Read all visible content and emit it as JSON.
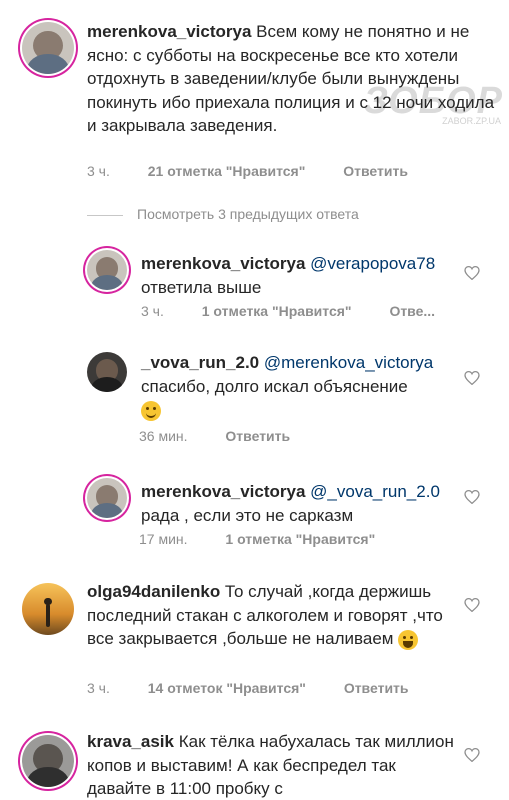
{
  "watermark": {
    "text": "ЗОБОР",
    "sub": "ZABOR.ZP.UA"
  },
  "view_replies": "Посмотреть 3 предыдущих ответа",
  "comments": [
    {
      "username": "merenkova_victorya",
      "text": " Всем кому не понятно и не ясно: с субботы на воскресенье все кто хотели отдохнуть в заведении/клубе были вынуждены покинуть ибо приехала полиция и с 12 ночи ходила и закрывала заведения.",
      "time": "3 ч.",
      "likes": "21 отметка \"Нравится\"",
      "reply": "Ответить"
    },
    {
      "username": "merenkova_victorya",
      "mention": " @verapopova78",
      "text": "ответила выше",
      "time": "3 ч.",
      "likes": "1 отметка \"Нравится\"",
      "reply": "Отве..."
    },
    {
      "username": "_vova_run_2.0",
      "mention": " @merenkova_victorya",
      "text": "спасибо, долго искал объяснение",
      "time": "36 мин.",
      "reply": "Ответить"
    },
    {
      "username": "merenkova_victorya",
      "mention": " @_vova_run_2.0",
      "text": "рада , если это не сарказм",
      "time": "17 мин.",
      "likes": "1 отметка \"Нравится\""
    },
    {
      "username": "olga94danilenko",
      "text": " То случай ,когда держишь последний стакан с алкоголем и говорят ,что все закрывается ,больше не наливаем",
      "time": "3 ч.",
      "likes": "14 отметок \"Нравится\"",
      "reply": "Ответить"
    },
    {
      "username": "krava_asik",
      "text": " Как тёлка набухалась так миллион копов и выставим! А как беспредел так давайте в 11:00 пробку с"
    }
  ],
  "colors": {
    "accent_ring": "#d6249f",
    "mention": "#00376b",
    "meta": "#8e8e8e"
  }
}
